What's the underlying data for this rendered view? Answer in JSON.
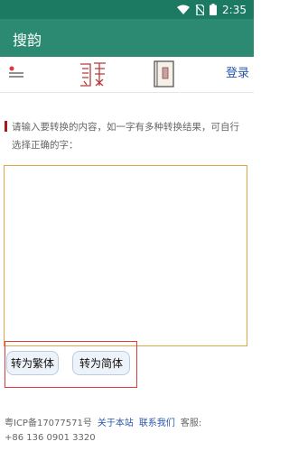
{
  "status_bar": {
    "time": "2:35"
  },
  "app": {
    "title": "搜韵"
  },
  "header": {
    "login": "登录"
  },
  "instruction": {
    "text": "请输入要转换的内容，如一字有多种转换结果，可自行选择正确的字："
  },
  "editor": {
    "value": "",
    "placeholder": ""
  },
  "buttons": {
    "traditional": "转为繁体",
    "simplified": "转为简体"
  },
  "footer": {
    "icp": "粤ICP备17077571号",
    "about": "关于本站",
    "contact": "联系我们",
    "service_label": "客服:",
    "phone": "+86 136 0901 3320"
  },
  "colors": {
    "app_bar": "#2b8a71",
    "status_bar": "#1c7a63",
    "accent_red": "#a31b1b",
    "link": "#2a56a8",
    "highlight": "#e33b3b"
  }
}
